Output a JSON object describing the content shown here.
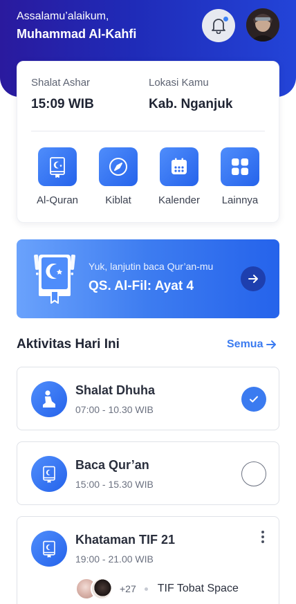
{
  "header": {
    "greeting": "Assalamu’alaikum,",
    "user_name": "Muhammad Al-Kahfi",
    "notification_icon": "bell-icon",
    "has_unread": true
  },
  "info": {
    "prayer_label": "Shalat Ashar",
    "prayer_time": "15:09 WIB",
    "location_label": "Lokasi Kamu",
    "location_value": "Kab. Nganjuk"
  },
  "features": [
    {
      "label": "Al-Quran",
      "icon": "quran-icon"
    },
    {
      "label": "Kiblat",
      "icon": "compass-icon"
    },
    {
      "label": "Kalender",
      "icon": "calendar-icon"
    },
    {
      "label": "Lainnya",
      "icon": "grid-icon"
    }
  ],
  "banner": {
    "subtitle": "Yuk, lanjutin baca Qur’an-mu",
    "title": "QS. Al-Fil: Ayat 4",
    "icon": "quran-book-icon"
  },
  "activities_section": {
    "title": "Aktivitas Hari Ini",
    "see_all": "Semua"
  },
  "activities": [
    {
      "title": "Shalat Dhuha",
      "time": "07:00 - 10.30 WIB",
      "icon": "praying-person-icon",
      "done": true
    },
    {
      "title": "Baca Qur’an",
      "time": "15:00 - 15.30 WIB",
      "icon": "quran-icon",
      "done": false
    },
    {
      "title": "Khataman TIF 21",
      "time": "19:00 - 21.00 WIB",
      "icon": "quran-icon",
      "extra_members": "+27",
      "group_name": "TIF Tobat Space"
    }
  ],
  "colors": {
    "primary": "#2563EB",
    "accent": "#3B7BF0",
    "header_gradient_start": "#2A1A9E",
    "header_gradient_end": "#2344D8"
  }
}
